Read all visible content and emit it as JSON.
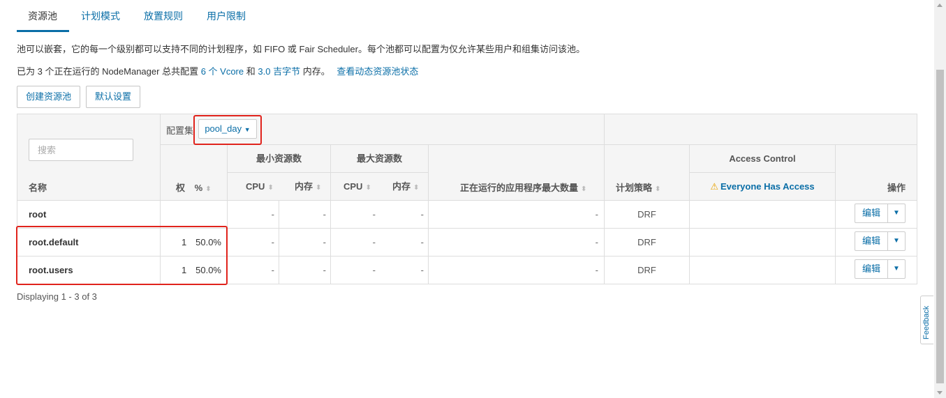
{
  "tabs": [
    {
      "label": "资源池",
      "active": true
    },
    {
      "label": "计划模式"
    },
    {
      "label": "放置规则"
    },
    {
      "label": "用户限制"
    }
  ],
  "intro": "池可以嵌套，它的每一个级别都可以支持不同的计划程序，如 FIFO 或 Fair Scheduler。每个池都可以配置为仅允许某些用户和组集访问该池。",
  "summary": {
    "prefix": "已为 3 个正在运行的 NodeManager 总共配置",
    "vcores": "6 个 Vcore",
    "and": "和",
    "memory": "3.0 吉字节",
    "suffix": "内存。",
    "link": "查看动态资源池状态"
  },
  "buttons": {
    "create": "创建资源池",
    "defaults": "默认设置"
  },
  "table": {
    "config_set_label": "配置集",
    "config_set_value": "pool_day",
    "search_placeholder": "搜索",
    "headers": {
      "name": "名称",
      "weight": "权",
      "percent": "%",
      "min_resources": "最小资源数",
      "max_resources": "最大资源数",
      "cpu": "CPU",
      "memory": "内存",
      "max_running_apps": "正在运行的应用程序最大数量",
      "scheduling_policy": "计划策略",
      "access_control": "Access Control",
      "everyone_access": "Everyone Has Access",
      "actions": "操作"
    },
    "rows": [
      {
        "name": "root",
        "weight": "",
        "percent": "",
        "min_cpu": "-",
        "min_mem": "-",
        "max_cpu": "-",
        "max_mem": "-",
        "max_apps": "-",
        "policy": "DRF",
        "edit": "编辑"
      },
      {
        "name": "root.default",
        "weight": "1",
        "percent": "50.0%",
        "min_cpu": "-",
        "min_mem": "-",
        "max_cpu": "-",
        "max_mem": "-",
        "max_apps": "-",
        "policy": "DRF",
        "edit": "编辑"
      },
      {
        "name": "root.users",
        "weight": "1",
        "percent": "50.0%",
        "min_cpu": "-",
        "min_mem": "-",
        "max_cpu": "-",
        "max_mem": "-",
        "max_apps": "-",
        "policy": "DRF",
        "edit": "编辑"
      }
    ]
  },
  "footer": "Displaying 1 - 3 of 3",
  "feedback": "Feedback",
  "colors": {
    "accent": "#0a6ea7",
    "highlight": "#e0231c",
    "warning": "#e8a200"
  }
}
